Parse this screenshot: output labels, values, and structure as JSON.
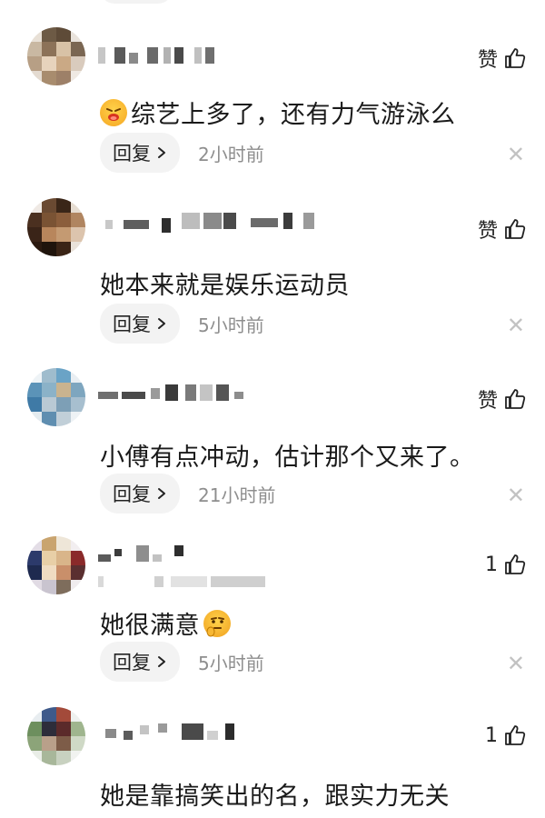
{
  "comments": [
    {
      "like_label": "赞",
      "text": "综艺上多了，还有力气游泳么",
      "emoji_before": "pouting-face-emoji",
      "reply_label": "回复",
      "time": "2小时前"
    },
    {
      "like_label": "赞",
      "text": "她本来就是娱乐运动员",
      "reply_label": "回复",
      "time": "5小时前"
    },
    {
      "like_label": "赞",
      "text": "小傅有点冲动，估计那个又来了。",
      "reply_label": "回复",
      "time": "21小时前"
    },
    {
      "like_label": "1",
      "text": "她很满意",
      "emoji_after": "thinking-face-emoji",
      "reply_label": "回复",
      "time": "5小时前"
    },
    {
      "like_label": "1",
      "text": "她是靠搞笑出的名，跟实力无关"
    }
  ],
  "icons": {
    "thumb": "thumbs-up-icon",
    "chevron": "chevron-right-icon",
    "close": "close-icon"
  },
  "colors": {
    "reply_bg": "#f3f3f3",
    "time_text": "#8e8e8e",
    "close_icon": "#c2c2c2"
  }
}
